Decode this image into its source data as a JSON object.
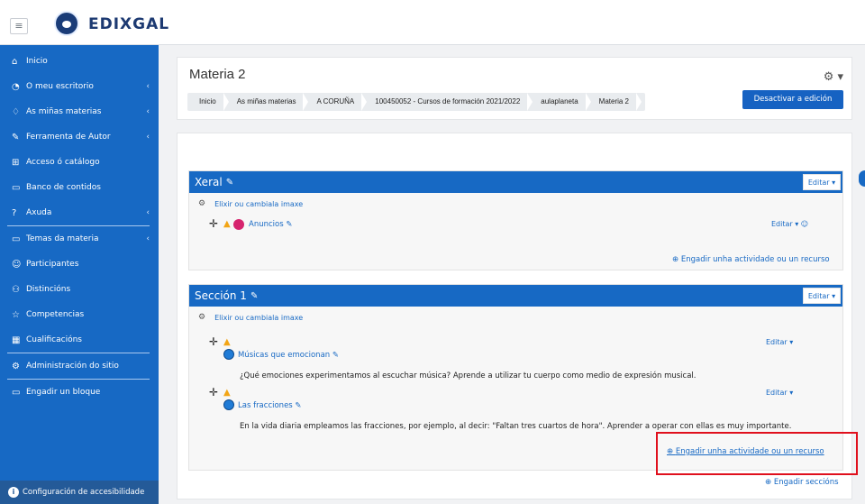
{
  "app": {
    "brand": "EDIXGAL",
    "menu_icon": "hamburger-icon"
  },
  "sidebar": {
    "items": [
      {
        "label": "Inicio",
        "icon": "home-icon",
        "chevron": false
      },
      {
        "label": "O meu escritorio",
        "icon": "dashboard-icon",
        "chevron": true
      },
      {
        "label": "As miñas materias",
        "icon": "graduation-cap-icon",
        "chevron": true
      },
      {
        "label": "Ferramenta de Autor",
        "icon": "pencil-icon",
        "chevron": true
      },
      {
        "label": "Acceso ó catálogo",
        "icon": "sitemap-icon",
        "chevron": false
      },
      {
        "label": "Banco de contidos",
        "icon": "clipboard-icon",
        "chevron": false
      },
      {
        "label": "Axuda",
        "icon": "help-icon",
        "chevron": true
      },
      {
        "label": "Temas da materia",
        "icon": "folder-icon",
        "chevron": true
      },
      {
        "label": "Participantes",
        "icon": "users-icon",
        "chevron": false
      },
      {
        "label": "Distincións",
        "icon": "badge-icon",
        "chevron": false
      },
      {
        "label": "Competencias",
        "icon": "star-icon",
        "chevron": false
      },
      {
        "label": "Cualificacións",
        "icon": "grades-icon",
        "chevron": false
      },
      {
        "label": "Administración do sitio",
        "icon": "gear-icon",
        "chevron": false
      },
      {
        "label": "Engadir un bloque",
        "icon": "add-block-icon",
        "chevron": false
      }
    ],
    "accessibility": "Configuración de accesibilidade"
  },
  "header": {
    "title": "Materia 2",
    "breadcrumbs": [
      "Inicio",
      "As miñas materias",
      "A CORUÑA",
      "100450052 - Cursos de formación 2021/2022",
      "aulaplaneta",
      "Materia 2"
    ],
    "edit_mode_button": "Desactivar a edición"
  },
  "sections": {
    "general": {
      "title": "Xeral",
      "edit": "Editar",
      "image_link": "Elixir ou cambiala imaxe",
      "activity_name": "Anuncios",
      "activity_edit": "Editar",
      "add": "Engadir unha actividade ou un recurso"
    },
    "section1": {
      "title": "Sección 1",
      "edit": "Editar",
      "image_link": "Elixir ou cambiala imaxe",
      "activities": [
        {
          "name": "Músicas que emocionan",
          "edit": "Editar",
          "desc": "¿Qué emociones experimentamos al escuchar música? Aprende a utilizar tu cuerpo como medio de expresión musical."
        },
        {
          "name": "Las fracciones",
          "edit": "Editar",
          "desc": "En la vida diaria empleamos las fracciones, por ejemplo, al decir: \"Faltan tres cuartos de hora\". Aprender a operar con ellas es muy importante."
        }
      ],
      "add": "Engadir unha actividade ou un recurso"
    }
  },
  "add_sections": "Engadir seccións",
  "colors": {
    "primary": "#1769c4",
    "highlight": "#e0101d",
    "warning": "#f2a516"
  }
}
